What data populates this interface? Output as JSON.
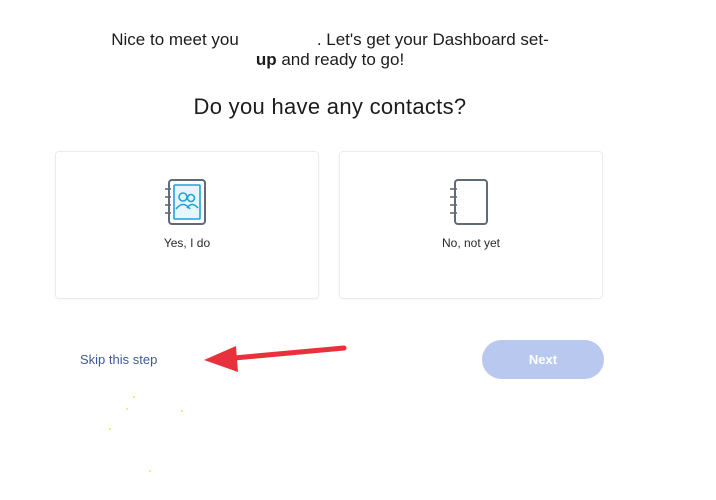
{
  "greeting": {
    "prefix": "Nice to meet you",
    "suffix": ". Let's get your Dashboard set-",
    "line2_bold": "up",
    "line2_rest": " and ready to go!"
  },
  "question": "Do you have any contacts?",
  "options": [
    {
      "label": "Yes, I do",
      "icon": "contacts-book-icon",
      "accent": "#1fa3d6"
    },
    {
      "label": "No, not yet",
      "icon": "empty-notebook-icon",
      "accent": "#6f7d8c"
    }
  ],
  "actions": {
    "skip_label": "Skip this step",
    "next_label": "Next"
  },
  "annotation": {
    "arrow_color": "#e8313b"
  }
}
